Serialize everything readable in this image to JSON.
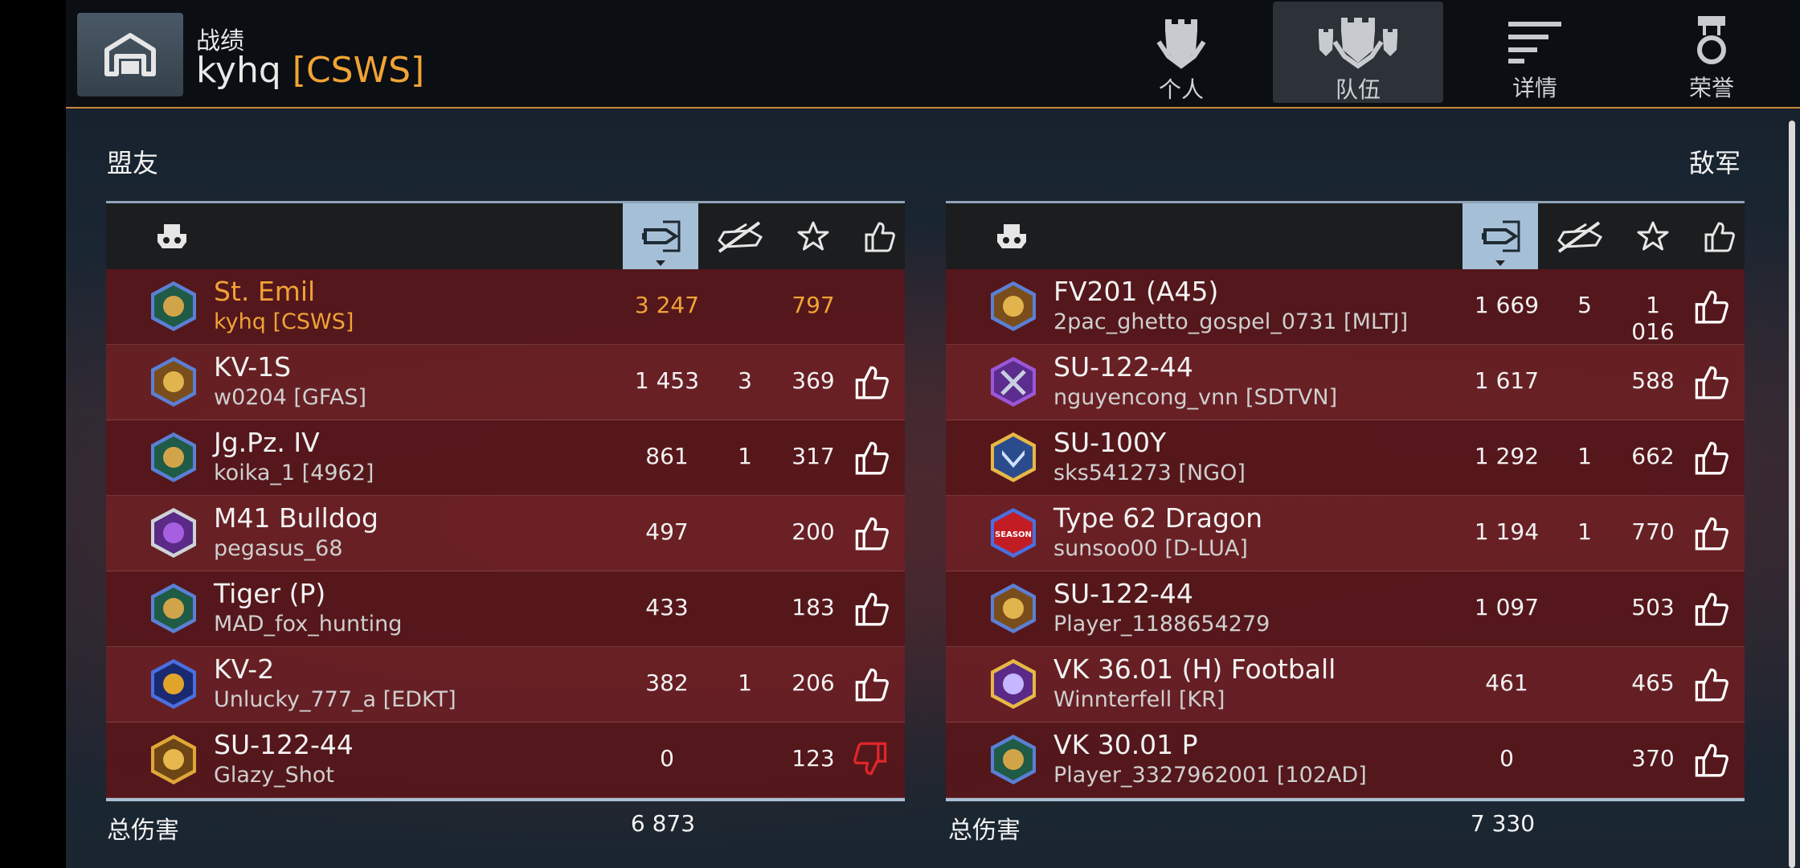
{
  "header": {
    "section_title": "战绩",
    "player_name": "kyhq",
    "player_clan": "[CSWS]",
    "tabs": [
      {
        "label": "个人",
        "icon": "personal-shield-icon"
      },
      {
        "label": "队伍",
        "icon": "team-shields-icon",
        "active": true
      },
      {
        "label": "详情",
        "icon": "details-list-icon"
      },
      {
        "label": "荣誉",
        "icon": "medal-icon"
      }
    ]
  },
  "allies": {
    "label": "盟友",
    "total_label": "总伤害",
    "total_damage": "6 873",
    "rows": [
      {
        "tank": "St. Emil",
        "player": "kyhq [CSWS]",
        "damage": "3 247",
        "kills": "",
        "exp": "797",
        "like": "none",
        "badge": "peacock",
        "me": true
      },
      {
        "tank": "KV-1S",
        "player": "w0204 [GFAS]",
        "damage": "1 453",
        "kills": "3",
        "exp": "369",
        "like": "up",
        "badge": "gold-eagle"
      },
      {
        "tank": "Jg.Pz. IV",
        "player": "koika_1 [4962]",
        "damage": "861",
        "kills": "1",
        "exp": "317",
        "like": "up",
        "badge": "peacock"
      },
      {
        "tank": "M41 Bulldog",
        "player": "pegasus_68",
        "damage": "497",
        "kills": "",
        "exp": "200",
        "like": "up",
        "badge": "purple-gem"
      },
      {
        "tank": "Tiger (P)",
        "player": "MAD_fox_hunting",
        "damage": "433",
        "kills": "",
        "exp": "183",
        "like": "up",
        "badge": "peacock"
      },
      {
        "tank": "KV-2",
        "player": "Unlucky_777_a [EDKT]",
        "damage": "382",
        "kills": "1",
        "exp": "206",
        "like": "up",
        "badge": "bull"
      },
      {
        "tank": "SU-122-44",
        "player": "Glazy_Shot",
        "damage": "0",
        "kills": "",
        "exp": "123",
        "like": "down",
        "badge": "gold-eagle-orange"
      }
    ]
  },
  "enemies": {
    "label": "敌军",
    "total_label": "总伤害",
    "total_damage": "7 330",
    "rows": [
      {
        "tank": "FV201 (A45)",
        "player": "2pac_ghetto_gospel_0731 [MLTJ]",
        "damage": "1 669",
        "kills": "5",
        "exp": "1 016",
        "like": "up",
        "badge": "gold-eagle"
      },
      {
        "tank": "SU-122-44",
        "player": "nguyencong_vnn [SDTVN]",
        "damage": "1 617",
        "kills": "",
        "exp": "588",
        "like": "up",
        "badge": "swords"
      },
      {
        "tank": "SU-100Y",
        "player": "sks541273 [NGO]",
        "damage": "1 292",
        "kills": "1",
        "exp": "662",
        "like": "up",
        "badge": "chevron"
      },
      {
        "tank": "Type 62 Dragon",
        "player": "sunsoo00 [D-LUA]",
        "damage": "1 194",
        "kills": "1",
        "exp": "770",
        "like": "up",
        "badge": "season",
        "badge_text": "SEASON"
      },
      {
        "tank": "SU-122-44",
        "player": "Player_1188654279",
        "damage": "1 097",
        "kills": "",
        "exp": "503",
        "like": "up",
        "badge": "gold-eagle"
      },
      {
        "tank": "VK 36.01 (H) Football",
        "player": "Winnterfell [KR]",
        "damage": "461",
        "kills": "",
        "exp": "465",
        "like": "up",
        "badge": "hand"
      },
      {
        "tank": "VK 30.01 P",
        "player": "Player_3327962001 [102AD]",
        "damage": "0",
        "kills": "",
        "exp": "370",
        "like": "up",
        "badge": "peacock"
      }
    ]
  },
  "colors": {
    "accent_orange": "#f0a335",
    "sorted_column": "#a5c0d6",
    "dislike_red": "#e0262b",
    "row_red": "#6e1e22"
  }
}
